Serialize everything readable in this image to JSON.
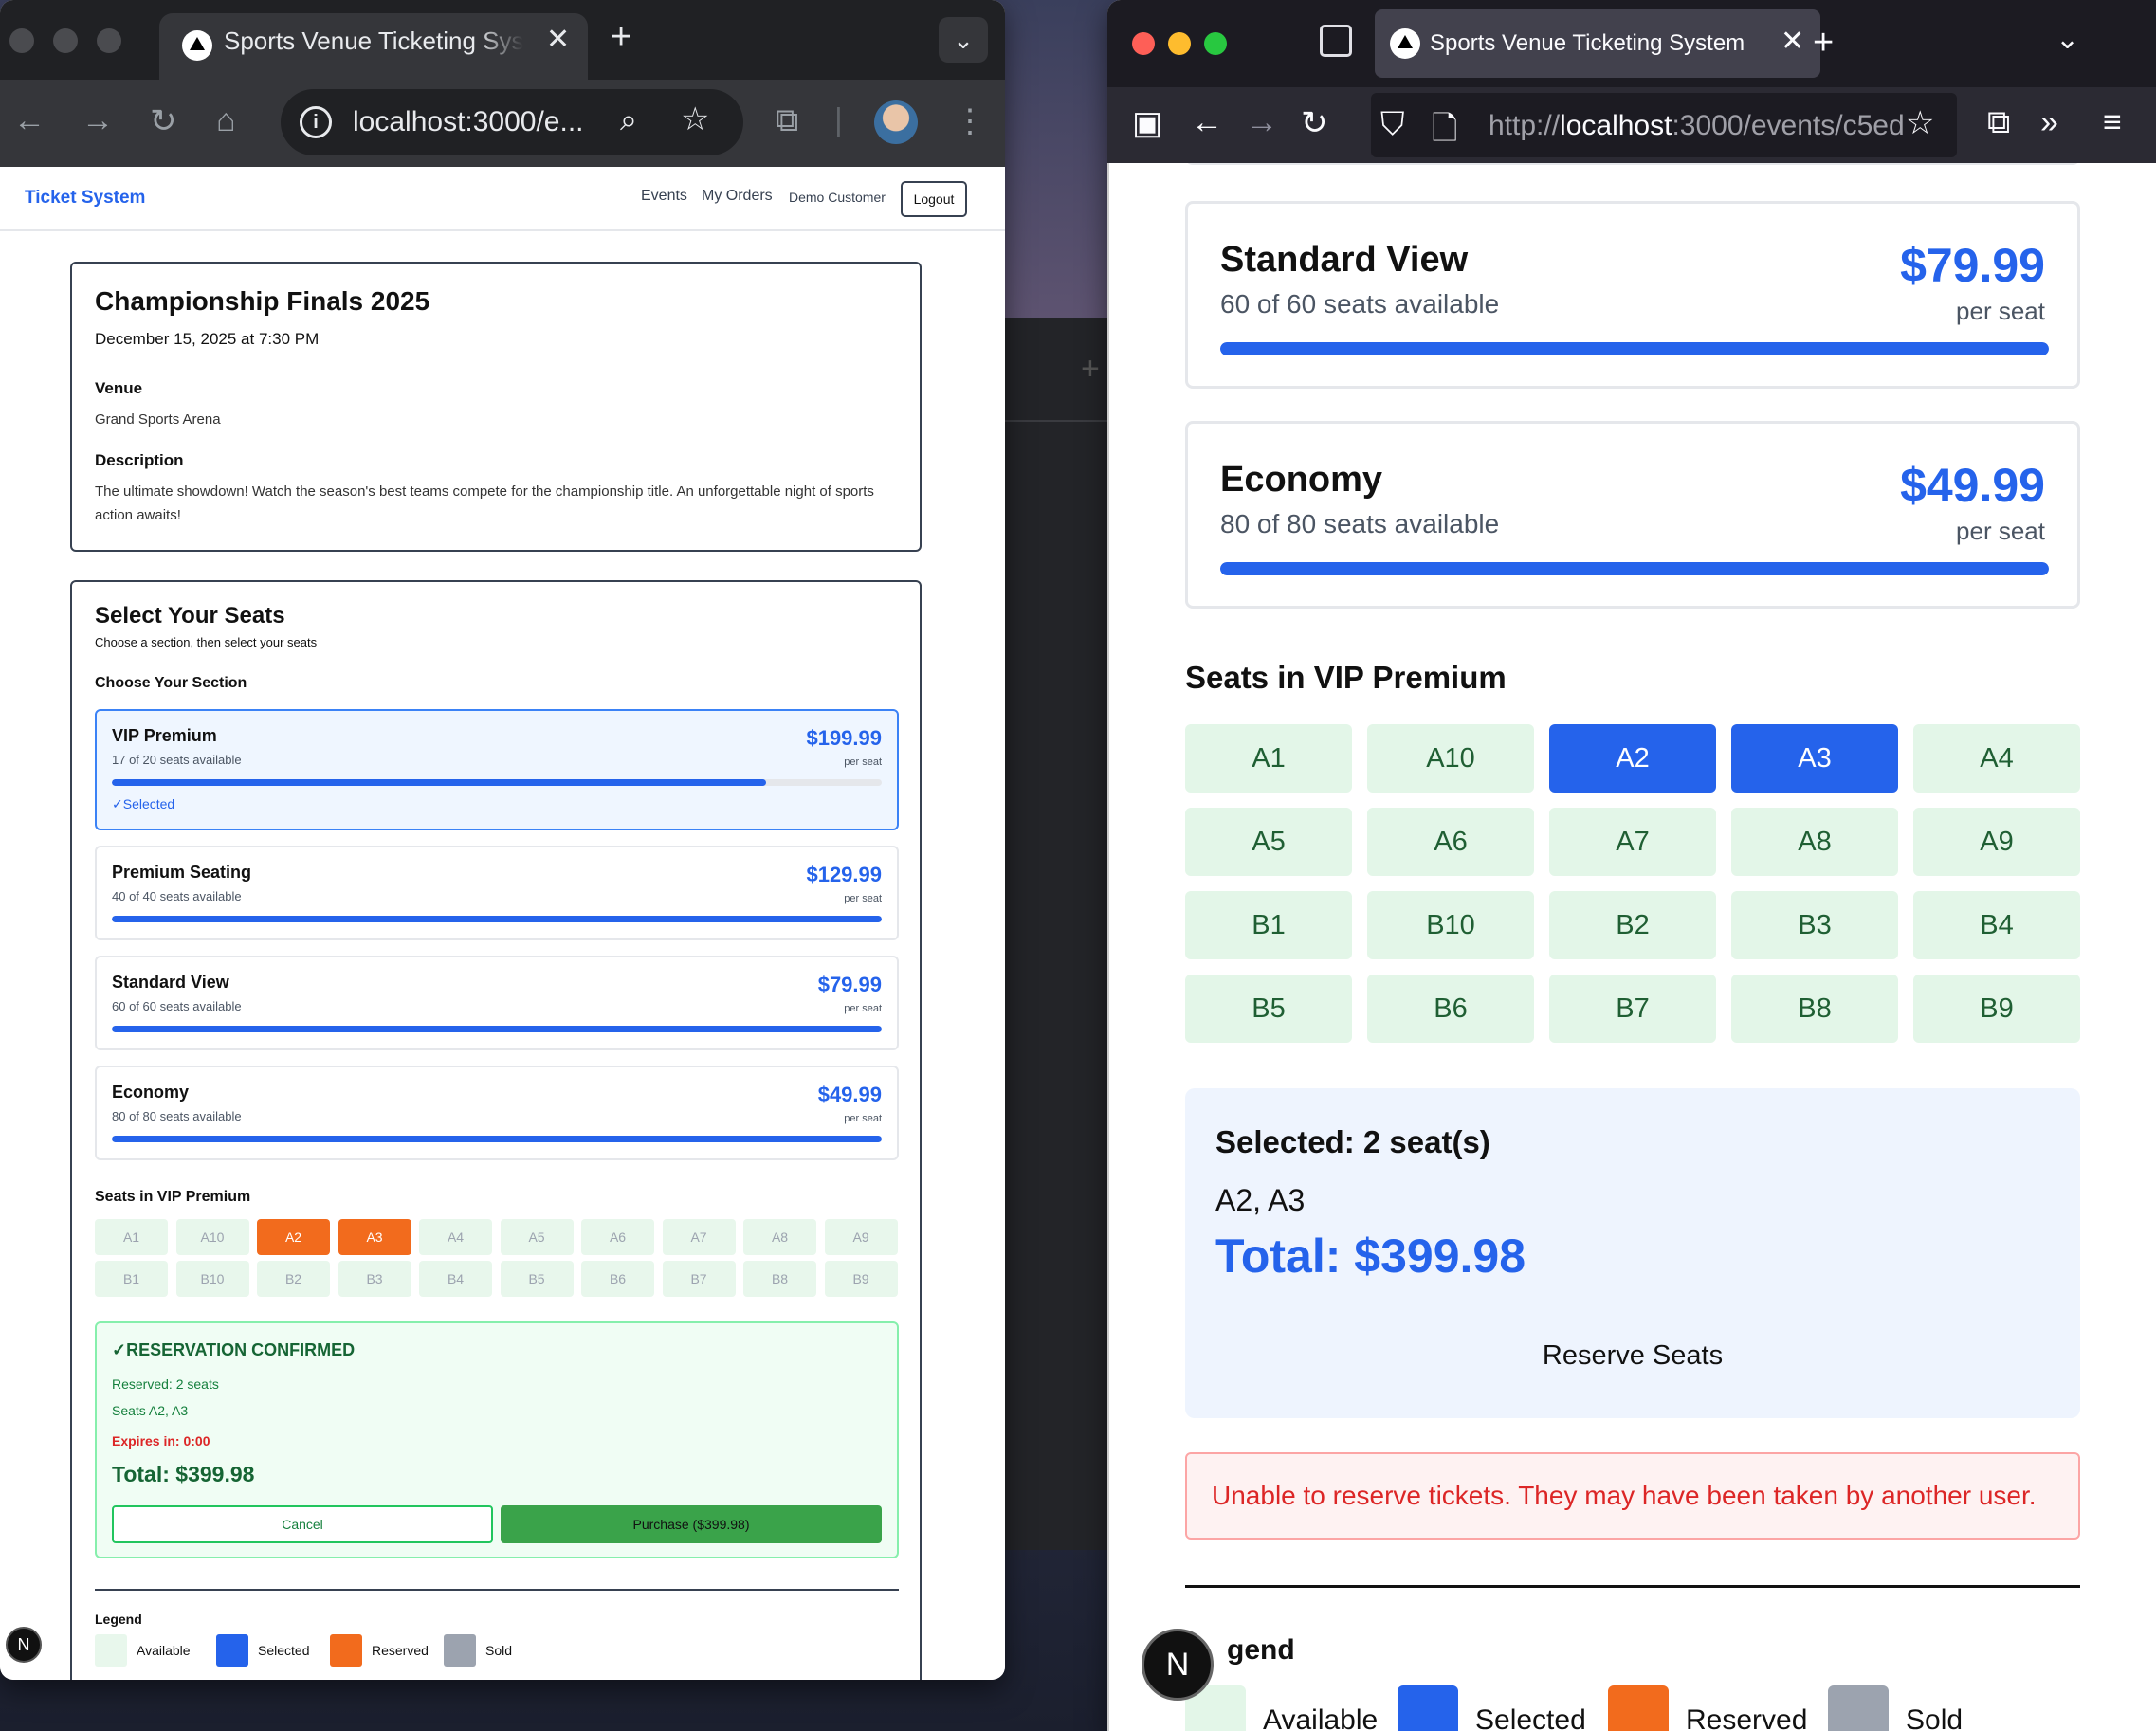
{
  "chrome": {
    "tab_title": "Sports Venue Ticketing System",
    "tab_close": "✕",
    "new_tab": "+",
    "url": "localhost:3000/e...",
    "nav": {
      "back": "←",
      "forward": "→",
      "reload": "↻",
      "home": "⌂",
      "menu": "⋮"
    }
  },
  "app": {
    "brand": "Ticket System",
    "nav_links": [
      "Events",
      "My Orders"
    ],
    "user": "Demo Customer",
    "logout": "Logout",
    "event": {
      "title": "Championship Finals 2025",
      "date": "December 15, 2025 at 7:30 PM",
      "venue_label": "Venue",
      "venue": "Grand Sports Arena",
      "description_label": "Description",
      "description": "The ultimate showdown! Watch the season's best teams compete for the championship title. An unforgettable night of sports action awaits!"
    },
    "select": {
      "title": "Select Your Seats",
      "subtitle": "Choose a section, then select your seats",
      "choose_label": "Choose Your Section",
      "per_seat": "per seat",
      "selected_text": "✓Selected",
      "sections": [
        {
          "name": "VIP Premium",
          "availability": "17 of 20 seats available",
          "price": "$199.99",
          "fill": 0.85
        },
        {
          "name": "Premium Seating",
          "availability": "40 of 40 seats available",
          "price": "$129.99",
          "fill": 1.0
        },
        {
          "name": "Standard View",
          "availability": "60 of 60 seats available",
          "price": "$79.99",
          "fill": 1.0
        },
        {
          "name": "Economy",
          "availability": "80 of 80 seats available",
          "price": "$49.99",
          "fill": 1.0
        }
      ],
      "seats_title": "Seats in VIP Premium",
      "seats": [
        {
          "label": "A1",
          "status": "available"
        },
        {
          "label": "A10",
          "status": "available"
        },
        {
          "label": "A2",
          "status": "reserved"
        },
        {
          "label": "A3",
          "status": "reserved"
        },
        {
          "label": "A4",
          "status": "available"
        },
        {
          "label": "A5",
          "status": "available"
        },
        {
          "label": "A6",
          "status": "available"
        },
        {
          "label": "A7",
          "status": "available"
        },
        {
          "label": "A8",
          "status": "available"
        },
        {
          "label": "A9",
          "status": "available"
        },
        {
          "label": "B1",
          "status": "available"
        },
        {
          "label": "B10",
          "status": "available"
        },
        {
          "label": "B2",
          "status": "available"
        },
        {
          "label": "B3",
          "status": "available"
        },
        {
          "label": "B4",
          "status": "available"
        },
        {
          "label": "B5",
          "status": "available"
        },
        {
          "label": "B6",
          "status": "available"
        },
        {
          "label": "B7",
          "status": "available"
        },
        {
          "label": "B8",
          "status": "available"
        },
        {
          "label": "B9",
          "status": "available"
        }
      ]
    },
    "reservation": {
      "title": "✓RESERVATION CONFIRMED",
      "reserved": "Reserved: 2 seats",
      "seats": "Seats A2, A3",
      "expires": "Expires in: 0:00",
      "total": "Total: $399.98",
      "cancel": "Cancel",
      "purchase": "Purchase ($399.98)"
    },
    "legend": {
      "title": "Legend",
      "items": [
        {
          "label": "Available",
          "color": "#e8f7ec"
        },
        {
          "label": "Selected",
          "color": "#2563eb"
        },
        {
          "label": "Reserved",
          "color": "#f26b1d"
        },
        {
          "label": "Sold",
          "color": "#9ca3af"
        }
      ]
    },
    "badge": "N"
  },
  "firefox": {
    "tab_title": "Sports Venue Ticketing System",
    "tab_close": "✕",
    "new_tab": "+",
    "url_scheme": "http://",
    "url_host": "localhost",
    "url_rest": ":3000/events/c5ed",
    "sections": [
      {
        "name": "Standard View",
        "availability": "60 of 60 seats available",
        "price": "$79.99",
        "fill": 1.0
      },
      {
        "name": "Economy",
        "availability": "80 of 80 seats available",
        "price": "$49.99",
        "fill": 1.0
      }
    ],
    "per_seat": "per seat",
    "seats_title": "Seats in VIP Premium",
    "seats": [
      {
        "label": "A1",
        "status": "available"
      },
      {
        "label": "A10",
        "status": "available"
      },
      {
        "label": "A2",
        "status": "selected"
      },
      {
        "label": "A3",
        "status": "selected"
      },
      {
        "label": "A4",
        "status": "available"
      },
      {
        "label": "A5",
        "status": "available"
      },
      {
        "label": "A6",
        "status": "available"
      },
      {
        "label": "A7",
        "status": "available"
      },
      {
        "label": "A8",
        "status": "available"
      },
      {
        "label": "A9",
        "status": "available"
      },
      {
        "label": "B1",
        "status": "available"
      },
      {
        "label": "B10",
        "status": "available"
      },
      {
        "label": "B2",
        "status": "available"
      },
      {
        "label": "B3",
        "status": "available"
      },
      {
        "label": "B4",
        "status": "available"
      },
      {
        "label": "B5",
        "status": "available"
      },
      {
        "label": "B6",
        "status": "available"
      },
      {
        "label": "B7",
        "status": "available"
      },
      {
        "label": "B8",
        "status": "available"
      },
      {
        "label": "B9",
        "status": "available"
      }
    ],
    "summary": {
      "title": "Selected: 2 seat(s)",
      "seats": "A2, A3",
      "total": "Total: $399.98",
      "reserve": "Reserve Seats"
    },
    "error": "Unable to reserve tickets. They may have been taken by another user.",
    "legend_title": "gend",
    "legend": [
      {
        "label": "Available",
        "color": "#e3f6e8"
      },
      {
        "label": "Selected",
        "color": "#2563eb"
      },
      {
        "label": "Reserved",
        "color": "#f26b1d"
      },
      {
        "label": "Sold",
        "color": "#9ca3af"
      }
    ],
    "badge": "N"
  }
}
